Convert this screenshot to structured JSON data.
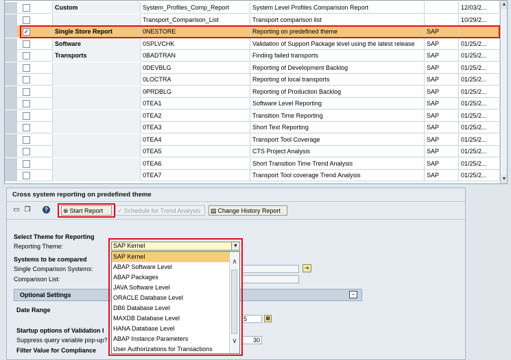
{
  "grid": {
    "rows": [
      {
        "checked": false,
        "group": "Custom",
        "id": "System_Profiles_Comp_Report",
        "desc": "System Level Profiles Comparision Report",
        "src": "",
        "date": "12/03/2..."
      },
      {
        "checked": false,
        "group": "",
        "id": "Transport_Comparison_List",
        "desc": "Transport comparison list",
        "src": "",
        "date": "10/29/2..."
      },
      {
        "checked": true,
        "group": "Single Store Report",
        "id": "0NESTORE",
        "desc": "Reporting on predefined theme",
        "src": "SAP",
        "date": ""
      },
      {
        "checked": false,
        "group": "Software",
        "id": "0SPLVCHK",
        "desc": "Validation of Support Package level using the latest release",
        "src": "SAP",
        "date": "01/25/2..."
      },
      {
        "checked": false,
        "group": "Transports",
        "id": "0BADTRAN",
        "desc": "Finding failed transports",
        "src": "SAP",
        "date": "01/25/2..."
      },
      {
        "checked": false,
        "group": "",
        "id": "0DEVBLG",
        "desc": "Reporting of Development Backlog",
        "src": "SAP",
        "date": "01/25/2..."
      },
      {
        "checked": false,
        "group": "",
        "id": "0LOCTRA",
        "desc": "Reporting of local transports",
        "src": "SAP",
        "date": "01/25/2..."
      },
      {
        "checked": false,
        "group": "",
        "id": "0PRDBLG",
        "desc": "Reporting of Production Backlog",
        "src": "SAP",
        "date": "01/25/2..."
      },
      {
        "checked": false,
        "group": "",
        "id": "0TEA1",
        "desc": "Software Level Reporting",
        "src": "SAP",
        "date": "01/25/2..."
      },
      {
        "checked": false,
        "group": "",
        "id": "0TEA2",
        "desc": "Transition Time Reporting",
        "src": "SAP",
        "date": "01/25/2..."
      },
      {
        "checked": false,
        "group": "",
        "id": "0TEA3",
        "desc": "Short Text Reporting",
        "src": "SAP",
        "date": "01/25/2..."
      },
      {
        "checked": false,
        "group": "",
        "id": "0TEA4",
        "desc": "Transport Tool Coverage",
        "src": "SAP",
        "date": "01/25/2..."
      },
      {
        "checked": false,
        "group": "",
        "id": "0TEA5",
        "desc": "CTS Project Analysis",
        "src": "SAP",
        "date": "01/25/2..."
      },
      {
        "checked": false,
        "group": "",
        "id": "0TEA6",
        "desc": "Short Transition Time Trend Analysis",
        "src": "SAP",
        "date": "01/25/2..."
      },
      {
        "checked": false,
        "group": "",
        "id": "0TEA7",
        "desc": "Transport Tool coverage Trend Analysis",
        "src": "SAP",
        "date": "01/25/2..."
      }
    ]
  },
  "panel": {
    "title": "Cross system reporting on predefined theme",
    "toolbar": {
      "start_report": "Start Report",
      "schedule": "Schedule for Trend Analysis",
      "change_history": "Change History Report"
    },
    "select_theme_heading": "Select Theme for Reporting",
    "reporting_theme_label": "Reporting Theme:",
    "systems_heading": "Systems to be compared",
    "single_systems_label": "Single Comparison Systems:",
    "comparison_list_label": "Comparison List:",
    "optional_settings": "Optional Settings",
    "date_range": "Date Range",
    "date_field_value": "5",
    "startup_options": "Startup options of Validation I",
    "suppress_label": "Suppress query variable pop-up?",
    "suppress_value": "30",
    "filter_value": "Filter Value for Compliance"
  },
  "dropdown": {
    "value": "SAP Kernel",
    "options": [
      "SAP Kernel",
      "ABAP Software Level",
      "ABAP Packages",
      "JAVA Software Level",
      "ORACLE Database Level",
      "DB6 Database Level",
      "MAXDB Database Level",
      "HANA Database Level",
      "ABAP Instance Parameters",
      "User Authorizations for Transactions"
    ],
    "selected_index": 0
  },
  "icons": {
    "start_report": "execute-icon",
    "schedule": "schedule-icon",
    "change_history": "history-icon",
    "toolbar": [
      "save-icon",
      "copy-icon",
      "help-icon"
    ],
    "dropdown_arrow": "chevron-down-icon",
    "scroll_up": "chevron-up-icon",
    "scroll_down": "chevron-down-icon",
    "collapse": "collapse-icon",
    "calendar": "calendar-icon",
    "value_help": "value-help-icon"
  },
  "colors": {
    "highlight_row": "#f3c67c",
    "annotation_red": "#e0101a",
    "selected_option": "#f6cd7d"
  }
}
